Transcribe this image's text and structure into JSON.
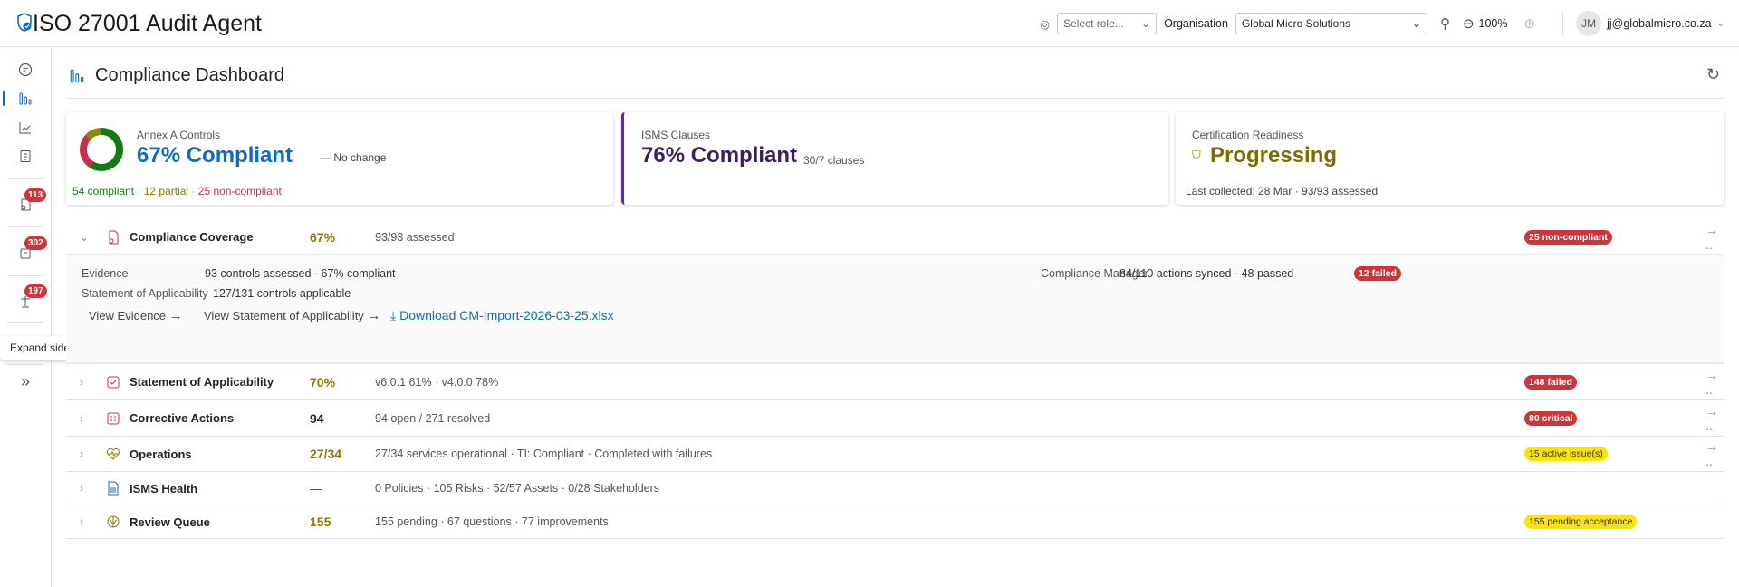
{
  "app": {
    "title": "ISO 27001 Audit Agent"
  },
  "header": {
    "role_placeholder": "Select role...",
    "org_label": "Organisation",
    "org_value": "Global Micro Solutions",
    "zoom": "100%",
    "avatar_initials": "JM",
    "user_email": "jj@globalmicro.co.za"
  },
  "sidebar": {
    "badges": [
      "113",
      "302",
      "197"
    ],
    "tooltip": "Expand sidebar"
  },
  "page": {
    "title": "Compliance Dashboard"
  },
  "cards": [
    {
      "label": "Annex A Controls",
      "value": "67% Compliant",
      "change": "No change",
      "compliant": "54 compliant",
      "partial": "12 partial",
      "noncompliant": "25 non-compliant",
      "donut": {
        "compliant": 54,
        "partial": 12,
        "noncompliant": 25
      }
    },
    {
      "label": "ISMS Clauses",
      "value": "76% Compliant",
      "sub": "30/7 clauses"
    },
    {
      "label": "Certification Readiness",
      "value": "Progressing",
      "footer": "Last collected: 28 Mar · 93/93 assessed"
    }
  ],
  "coverage": {
    "name": "Compliance Coverage",
    "value": "67%",
    "detail": "93/93 assessed",
    "badge": "25 non-compliant",
    "evidence_label": "Evidence",
    "evidence_value": "93 controls assessed · 67% compliant",
    "soa_label": "Statement of Applicability",
    "soa_value": "127/131 controls applicable",
    "cm_label": "Compliance Manager",
    "cm_value": "84/110 actions synced · 48 passed",
    "cm_badge": "12 failed",
    "link_evidence": "View Evidence",
    "link_soa": "View Statement of Applicability",
    "link_download": "Download CM-Import-2026-03-25.xlsx"
  },
  "rows": [
    {
      "name": "Statement of Applicability",
      "value": "70%",
      "detail": "v6.0.1 61% · v4.0.0 78%",
      "badge": "148 failed"
    },
    {
      "name": "Corrective Actions",
      "value": "94",
      "detail": "94 open / 271 resolved",
      "badge": "80 critical"
    },
    {
      "name": "Operations",
      "value": "27/34",
      "detail": "27/34 services operational · TI: Compliant · Completed with failures",
      "badge": "15 active issue(s)"
    },
    {
      "name": "ISMS Health",
      "value": "—",
      "detail": "0 Policies · 105 Risks · 52/57 Assets · 0/28 Stakeholders"
    },
    {
      "name": "Review Queue",
      "value": "155",
      "detail": "155 pending · 67 questions · 77 improvements",
      "badge": "155 pending acceptance"
    }
  ],
  "colors": {
    "accent": "#0f6cbd",
    "olive": "#8a7a00",
    "purple": "#3b1f5c",
    "red": "#d13438",
    "green": "#107c10",
    "yellow": "#fde300"
  }
}
